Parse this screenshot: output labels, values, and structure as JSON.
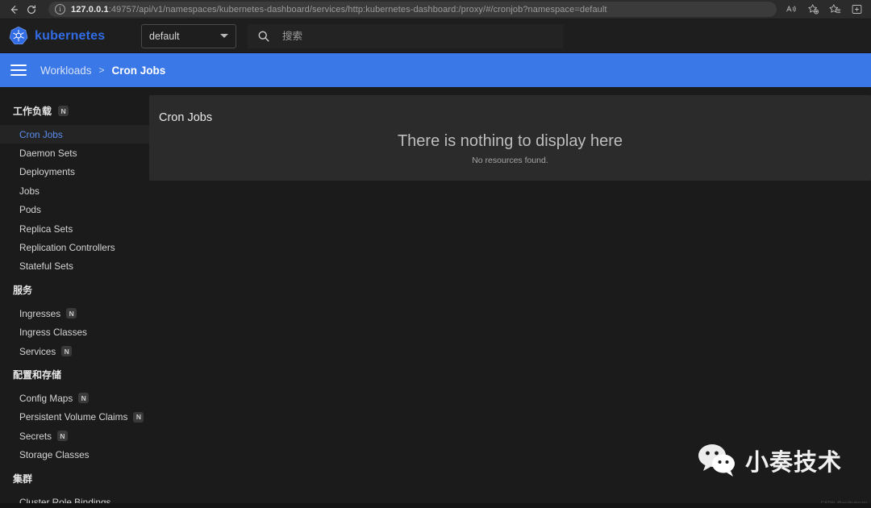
{
  "browser": {
    "back_icon": "back-arrow-icon",
    "reload_icon": "reload-icon",
    "info_icon": "site-info-icon",
    "url_host": "127.0.0.1",
    "url_rest": ":49757/api/v1/namespaces/kubernetes-dashboard/services/http:kubernetes-dashboard:/proxy/#/cronjob?namespace=default",
    "toolbar_icons": [
      "read-aloud-icon",
      "add-favorite-icon",
      "favorites-icon",
      "collections-icon"
    ]
  },
  "header": {
    "brand": "kubernetes",
    "logo_icon": "kubernetes-logo-icon",
    "namespace_value": "default",
    "namespace_chevron": "chevron-down-icon",
    "search_icon": "search-icon",
    "search_placeholder": "搜索",
    "search_value": ""
  },
  "breadcrumb": {
    "menu_icon": "hamburger-menu-icon",
    "parent": "Workloads",
    "separator": ">",
    "current": "Cron Jobs"
  },
  "sidebar": {
    "groups": [
      {
        "title": "工作负载",
        "title_badge": "N",
        "items": [
          {
            "label": "Cron Jobs",
            "badge": "",
            "active": true
          },
          {
            "label": "Daemon Sets",
            "badge": "",
            "active": false
          },
          {
            "label": "Deployments",
            "badge": "",
            "active": false
          },
          {
            "label": "Jobs",
            "badge": "",
            "active": false
          },
          {
            "label": "Pods",
            "badge": "",
            "active": false
          },
          {
            "label": "Replica Sets",
            "badge": "",
            "active": false
          },
          {
            "label": "Replication Controllers",
            "badge": "",
            "active": false
          },
          {
            "label": "Stateful Sets",
            "badge": "",
            "active": false
          }
        ]
      },
      {
        "title": "服务",
        "title_badge": "",
        "items": [
          {
            "label": "Ingresses",
            "badge": "N",
            "active": false
          },
          {
            "label": "Ingress Classes",
            "badge": "",
            "active": false
          },
          {
            "label": "Services",
            "badge": "N",
            "active": false
          }
        ]
      },
      {
        "title": "配置和存储",
        "title_badge": "",
        "items": [
          {
            "label": "Config Maps",
            "badge": "N",
            "active": false
          },
          {
            "label": "Persistent Volume Claims",
            "badge": "N",
            "active": false
          },
          {
            "label": "Secrets",
            "badge": "N",
            "active": false
          },
          {
            "label": "Storage Classes",
            "badge": "",
            "active": false
          }
        ]
      },
      {
        "title": "集群",
        "title_badge": "",
        "items": [
          {
            "label": "Cluster Role Bindings",
            "badge": "",
            "active": false
          }
        ]
      }
    ]
  },
  "main": {
    "card_title": "Cron Jobs",
    "empty_title": "There is nothing to display here",
    "empty_subtitle": "No resources found."
  },
  "watermark": {
    "icon": "wechat-icon",
    "text": "小奏技术",
    "credit": "CSDN @weihubeats"
  },
  "colors": {
    "accent_blue": "#3b78e7",
    "brand_blue": "#326ce5",
    "active_item": "#5b8dee",
    "page_bg": "#1b1b1b",
    "card_bg": "#2b2b2b"
  }
}
